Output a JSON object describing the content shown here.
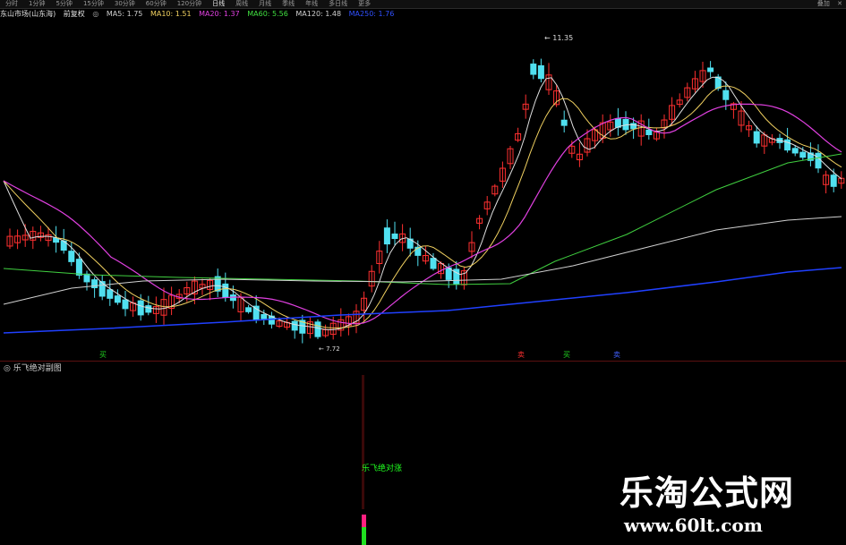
{
  "toolbar": {
    "tabs": [
      "分时",
      "1分钟",
      "5分钟",
      "15分钟",
      "30分钟",
      "60分钟",
      "120分钟",
      "日线",
      "周线",
      "月线",
      "季线",
      "年线",
      "多日线",
      "更多"
    ],
    "active_tab": "日线",
    "right_label": "叠加"
  },
  "info": {
    "stock": "东山市场(山东海)",
    "period": "前复权",
    "ma5": "MA5: 1.75",
    "ma10": "MA10: 1.51",
    "ma20": "MA20: 1.37",
    "ma60": "MA60: 5.56",
    "ma120": "MA120: 1.48",
    "ma250": "MA250: 1.76"
  },
  "annotations": {
    "peak": "11.35",
    "low": "7.72"
  },
  "markers": [
    {
      "text": "买",
      "color": "#20d020"
    },
    {
      "text": "卖",
      "color": "#ff3030"
    },
    {
      "text": "买",
      "color": "#20d020"
    },
    {
      "text": "卖",
      "color": "#4060ff"
    }
  ],
  "indicator": {
    "name": "乐飞绝对副图",
    "signal": "乐飞绝对涨"
  },
  "watermark": {
    "cn": "乐淘公式网",
    "url": "www.60lt.com"
  },
  "colors": {
    "up": "#ff3030",
    "down": "#50e0f0",
    "ma5": "#e0e0e0",
    "ma10": "#f0d060",
    "ma20": "#e040e0",
    "ma60": "#40d040",
    "ma120": "#d0d0d0",
    "ma250": "#2040ff"
  }
}
